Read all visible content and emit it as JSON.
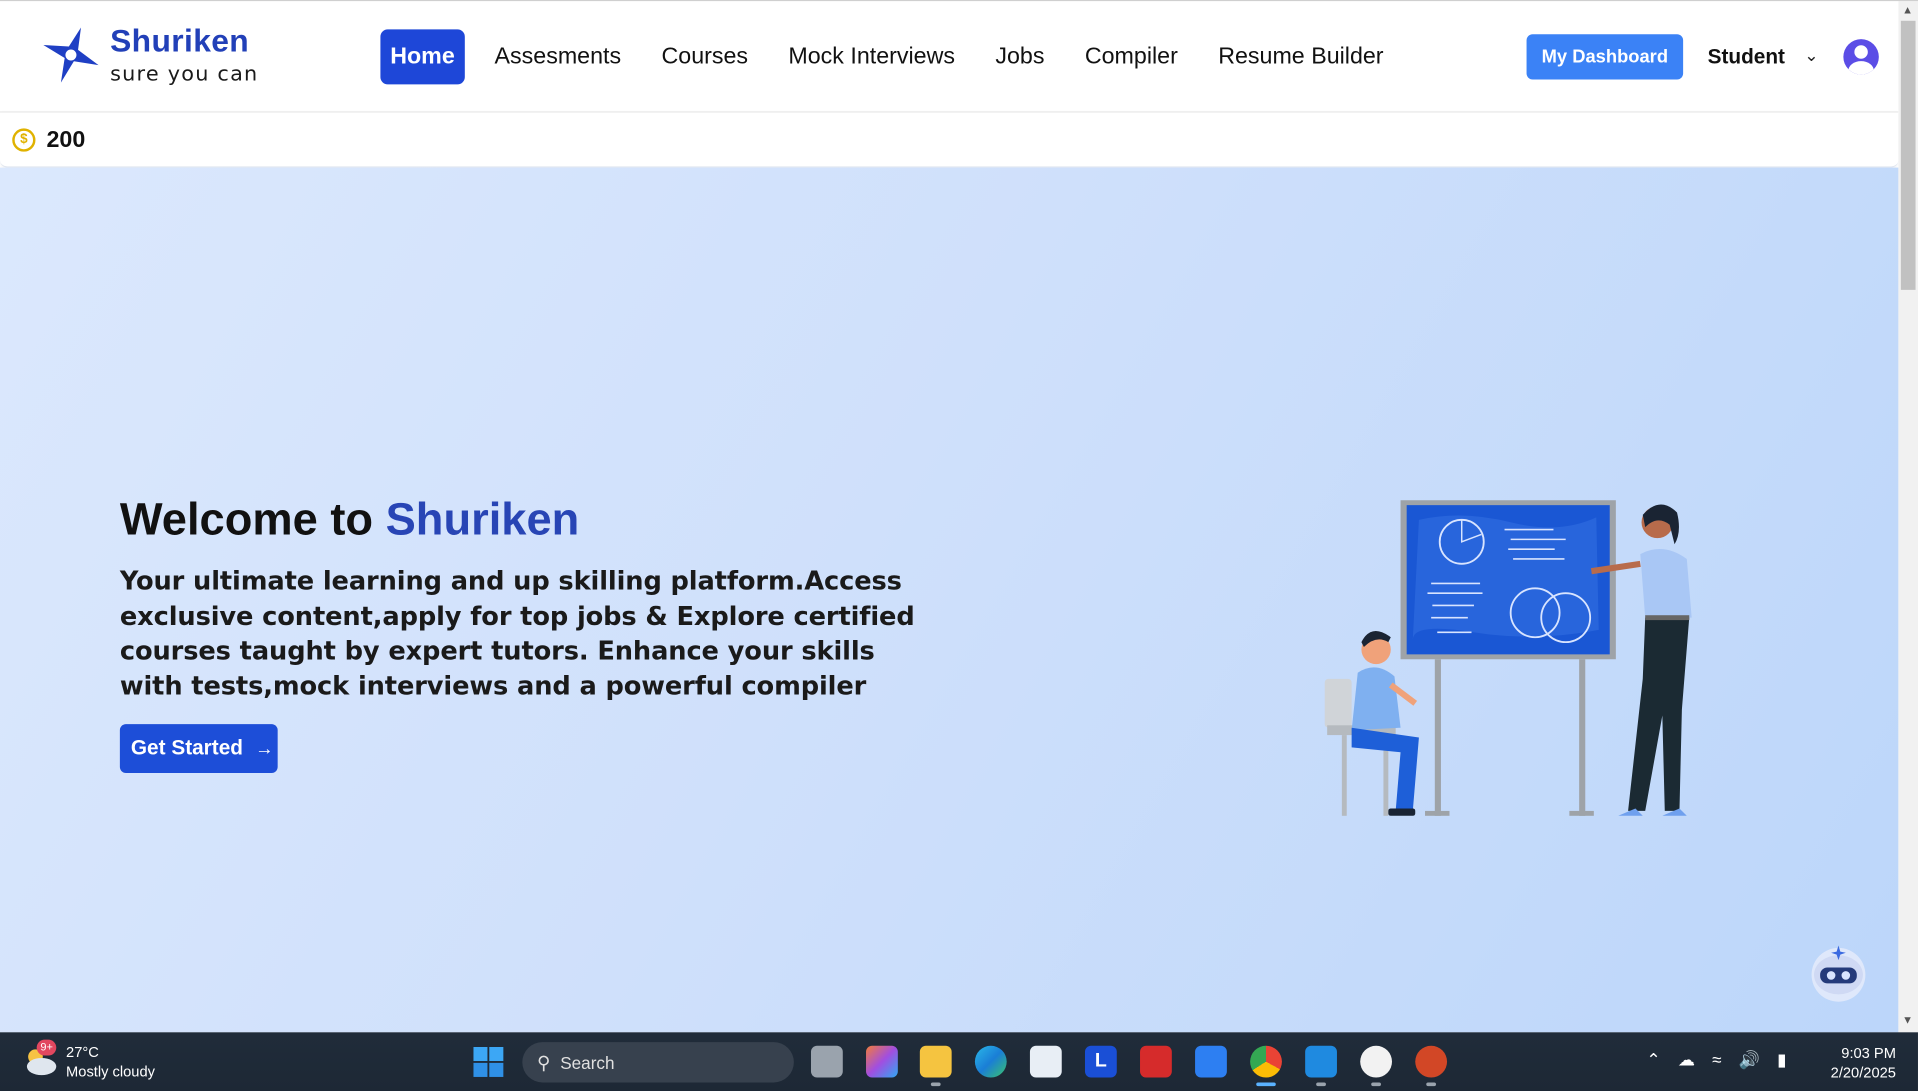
{
  "brand": {
    "name": "Shuriken",
    "tagline": "sure you can"
  },
  "nav": {
    "items": [
      {
        "label": "Home",
        "active": true
      },
      {
        "label": "Assesments"
      },
      {
        "label": "Courses"
      },
      {
        "label": "Mock Interviews"
      },
      {
        "label": "Jobs"
      },
      {
        "label": "Compiler"
      },
      {
        "label": "Resume Builder"
      }
    ],
    "dashboard_label": "My Dashboard",
    "role_label": "Student"
  },
  "coins": {
    "count": "200",
    "icon": "coin-icon"
  },
  "hero": {
    "title_prefix": "Welcome to ",
    "title_accent": "Shuriken",
    "description": "Your ultimate learning and up skilling platform.Access exclusive content,apply for top jobs & Explore certified courses taught by expert tutors. Enhance your skills with tests,mock interviews and a powerful compiler",
    "cta_label": "Get Started"
  },
  "taskbar": {
    "weather_temp": "27°C",
    "weather_desc": "Mostly cloudy",
    "weather_badge": "9+",
    "search_placeholder": "Search",
    "time": "9:03 PM",
    "date": "2/20/2025",
    "apps": [
      "task-view",
      "copilot",
      "file-explorer",
      "edge",
      "microsoft-store",
      "l-app",
      "mcafee",
      "dropbox",
      "chrome",
      "vscode",
      "mongodb-compass",
      "powerpoint"
    ]
  },
  "colors": {
    "accent": "#1e47d8",
    "brand": "#2240b8",
    "button": "#3b82f6",
    "hero_bg": "#d3e3fc"
  }
}
